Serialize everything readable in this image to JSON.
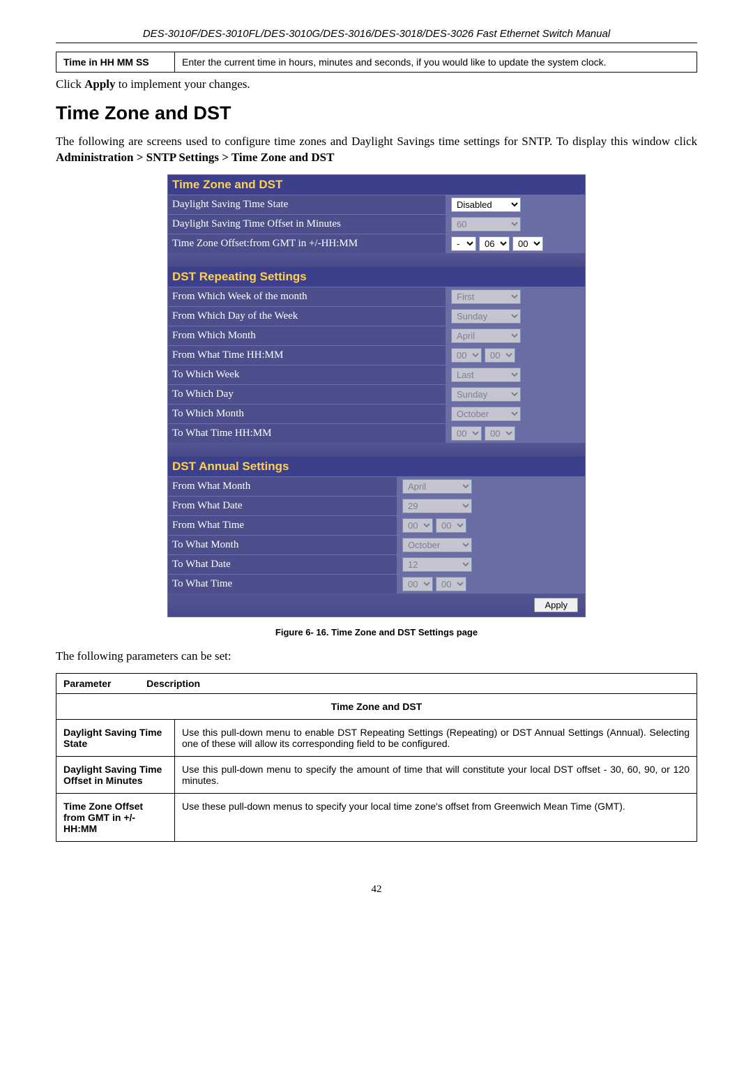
{
  "doc_header": "DES-3010F/DES-3010FL/DES-3010G/DES-3016/DES-3018/DES-3026 Fast Ethernet Switch Manual",
  "top_table": {
    "label": "Time in HH MM SS",
    "desc": "Enter the current time in hours, minutes and seconds, if you would like to update the system clock."
  },
  "apply_sentence_pre": "Click ",
  "apply_bold": "Apply",
  "apply_sentence_post": " to implement your changes.",
  "h2": "Time Zone and DST",
  "intro_pre": "The following are screens used to configure time zones and Daylight Savings time settings for SNTP. To display this window click ",
  "intro_bold": "Administration > SNTP Settings > Time Zone and DST",
  "panel": {
    "tzdst_header": "Time Zone and DST",
    "rows_top": [
      {
        "label": "Daylight Saving Time State",
        "ctrl": {
          "type": "select",
          "value": "Disabled",
          "enabled": true
        }
      },
      {
        "label": "Daylight Saving Time Offset in Minutes",
        "ctrl": {
          "type": "select",
          "value": "60",
          "enabled": false
        }
      },
      {
        "label": "Time Zone Offset:from GMT in +/-HH:MM",
        "ctrl": {
          "type": "triple",
          "sign": "-",
          "hh": "06",
          "mm": "00",
          "enabled": true
        }
      }
    ],
    "repeat_header": "DST Repeating Settings",
    "rows_repeat": [
      {
        "label": "From Which Week of the month",
        "ctrl": {
          "type": "select",
          "value": "First",
          "enabled": false
        }
      },
      {
        "label": "From Which Day of the Week",
        "ctrl": {
          "type": "select",
          "value": "Sunday",
          "enabled": false
        }
      },
      {
        "label": "From Which Month",
        "ctrl": {
          "type": "select",
          "value": "April",
          "enabled": false
        }
      },
      {
        "label": "From What Time HH:MM",
        "ctrl": {
          "type": "double",
          "hh": "00",
          "mm": "00",
          "enabled": false
        }
      },
      {
        "label": "To Which Week",
        "ctrl": {
          "type": "select",
          "value": "Last",
          "enabled": false
        }
      },
      {
        "label": "To Which Day",
        "ctrl": {
          "type": "select",
          "value": "Sunday",
          "enabled": false
        }
      },
      {
        "label": "To Which Month",
        "ctrl": {
          "type": "select",
          "value": "October",
          "enabled": false
        }
      },
      {
        "label": "To What Time HH:MM",
        "ctrl": {
          "type": "double",
          "hh": "00",
          "mm": "00",
          "enabled": false
        }
      }
    ],
    "annual_header": "DST Annual Settings",
    "rows_annual": [
      {
        "label": "From What Month",
        "ctrl": {
          "type": "select",
          "value": "April",
          "enabled": false
        }
      },
      {
        "label": "From What Date",
        "ctrl": {
          "type": "select",
          "value": "29",
          "enabled": false
        }
      },
      {
        "label": "From What Time",
        "ctrl": {
          "type": "double",
          "hh": "00",
          "mm": "00",
          "enabled": false
        }
      },
      {
        "label": "To What Month",
        "ctrl": {
          "type": "select",
          "value": "October",
          "enabled": false
        }
      },
      {
        "label": "To What Date",
        "ctrl": {
          "type": "select",
          "value": "12",
          "enabled": false
        }
      },
      {
        "label": "To What Time",
        "ctrl": {
          "type": "double",
          "hh": "00",
          "mm": "00",
          "enabled": false
        }
      }
    ],
    "apply_label": "Apply"
  },
  "figure_caption": "Figure 6- 16. Time Zone and DST Settings page",
  "params_intro": "The following parameters can be set:",
  "param_head_param": "Parameter",
  "param_head_desc": "Description",
  "param_section": "Time Zone and DST",
  "params": [
    {
      "label": "Daylight Saving Time State",
      "desc": "Use this pull-down menu to enable DST Repeating Settings (Repeating) or DST Annual Settings (Annual). Selecting one of these will allow its corresponding field to be configured."
    },
    {
      "label": "Daylight Saving Time Offset in Minutes",
      "desc": "Use this pull-down menu to specify the amount of time that will constitute your local DST offset - 30, 60, 90, or 120 minutes."
    },
    {
      "label": "Time Zone Offset from GMT in +/- HH:MM",
      "desc": "Use these pull-down menus to specify your local time zone's offset from Greenwich Mean Time (GMT)."
    }
  ],
  "page_number": "42"
}
